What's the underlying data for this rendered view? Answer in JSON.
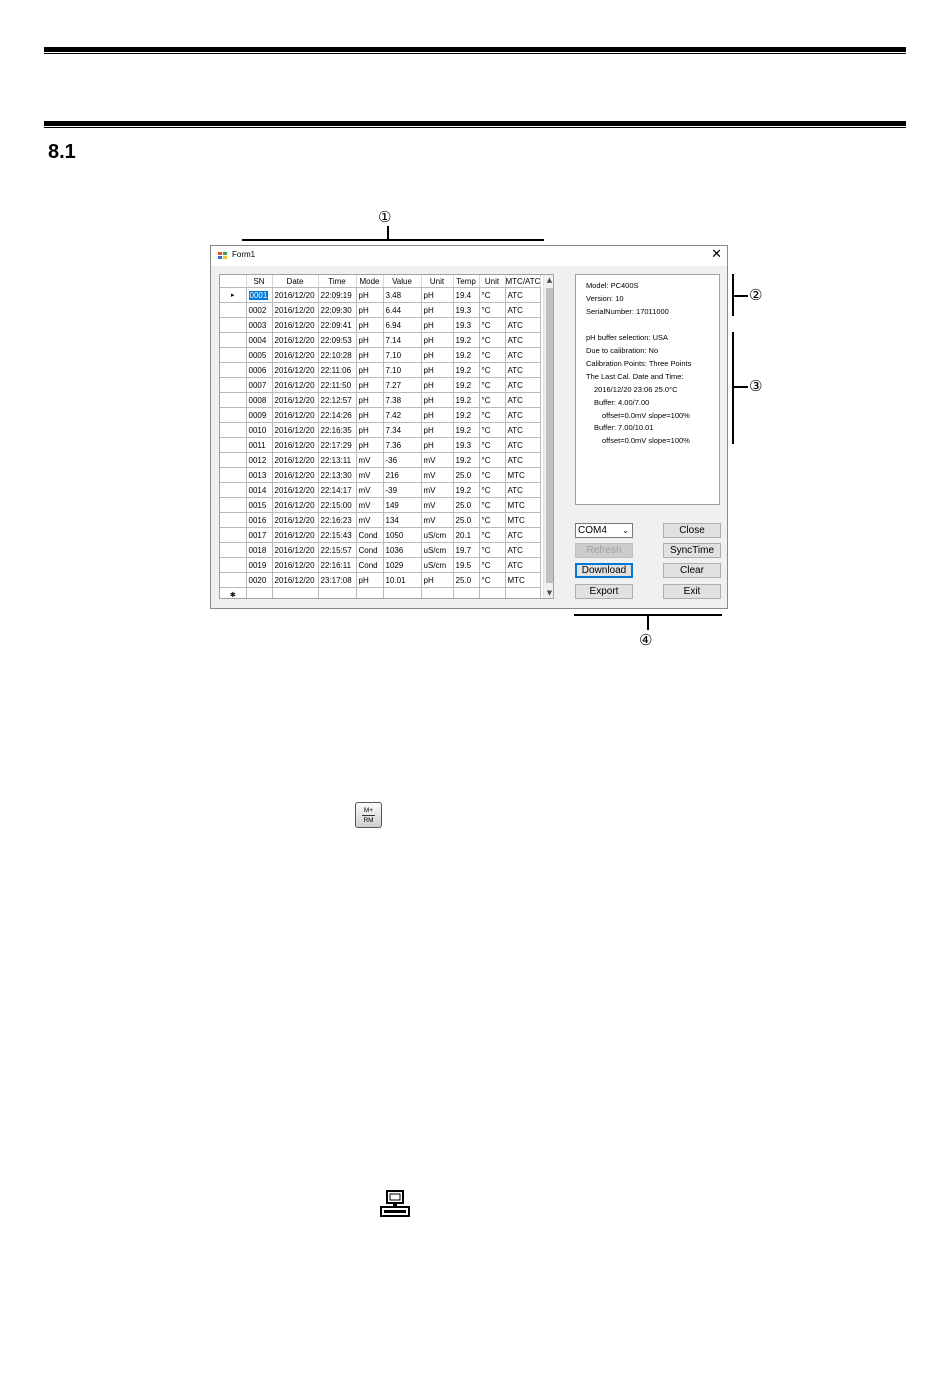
{
  "section": {
    "number": "8.1"
  },
  "callouts": [
    "①",
    "②",
    "③",
    "④"
  ],
  "window": {
    "title": "Form1",
    "close_glyph": "✕",
    "columns": [
      "SN",
      "Date",
      "Time",
      "Mode",
      "Value",
      "Unit",
      "Temp",
      "Unit",
      "MTC/ATC"
    ],
    "rows": [
      [
        "0001",
        "2016/12/20",
        "22:09:19",
        "pH",
        "3.48",
        "pH",
        "19.4",
        "°C",
        "ATC"
      ],
      [
        "0002",
        "2016/12/20",
        "22:09:30",
        "pH",
        "6.44",
        "pH",
        "19.3",
        "°C",
        "ATC"
      ],
      [
        "0003",
        "2016/12/20",
        "22:09:41",
        "pH",
        "6.94",
        "pH",
        "19.3",
        "°C",
        "ATC"
      ],
      [
        "0004",
        "2016/12/20",
        "22:09:53",
        "pH",
        "7.14",
        "pH",
        "19.2",
        "°C",
        "ATC"
      ],
      [
        "0005",
        "2016/12/20",
        "22:10:28",
        "pH",
        "7.10",
        "pH",
        "19.2",
        "°C",
        "ATC"
      ],
      [
        "0006",
        "2016/12/20",
        "22:11:06",
        "pH",
        "7.10",
        "pH",
        "19.2",
        "°C",
        "ATC"
      ],
      [
        "0007",
        "2016/12/20",
        "22:11:50",
        "pH",
        "7.27",
        "pH",
        "19.2",
        "°C",
        "ATC"
      ],
      [
        "0008",
        "2016/12/20",
        "22:12:57",
        "pH",
        "7.38",
        "pH",
        "19.2",
        "°C",
        "ATC"
      ],
      [
        "0009",
        "2016/12/20",
        "22:14:26",
        "pH",
        "7.42",
        "pH",
        "19.2",
        "°C",
        "ATC"
      ],
      [
        "0010",
        "2016/12/20",
        "22:16:35",
        "pH",
        "7.34",
        "pH",
        "19.2",
        "°C",
        "ATC"
      ],
      [
        "0011",
        "2016/12/20",
        "22:17:29",
        "pH",
        "7.36",
        "pH",
        "19.3",
        "°C",
        "ATC"
      ],
      [
        "0012",
        "2016/12/20",
        "22:13:11",
        "mV",
        "-36",
        "mV",
        "19.2",
        "°C",
        "ATC"
      ],
      [
        "0013",
        "2016/12/20",
        "22:13:30",
        "mV",
        "216",
        "mV",
        "25.0",
        "°C",
        "MTC"
      ],
      [
        "0014",
        "2016/12/20",
        "22:14:17",
        "mV",
        "-39",
        "mV",
        "19.2",
        "°C",
        "ATC"
      ],
      [
        "0015",
        "2016/12/20",
        "22:15:00",
        "mV",
        "149",
        "mV",
        "25.0",
        "°C",
        "MTC"
      ],
      [
        "0016",
        "2016/12/20",
        "22:16:23",
        "mV",
        "134",
        "mV",
        "25.0",
        "°C",
        "MTC"
      ],
      [
        "0017",
        "2016/12/20",
        "22:15:43",
        "Cond",
        "1050",
        "uS/cm",
        "20.1",
        "°C",
        "ATC"
      ],
      [
        "0018",
        "2016/12/20",
        "22:15:57",
        "Cond",
        "1036",
        "uS/cm",
        "19.7",
        "°C",
        "ATC"
      ],
      [
        "0019",
        "2016/12/20",
        "22:16:11",
        "Cond",
        "1029",
        "uS/cm",
        "19.5",
        "°C",
        "ATC"
      ],
      [
        "0020",
        "2016/12/20",
        "23:17:08",
        "pH",
        "10.01",
        "pH",
        "25.0",
        "°C",
        "MTC"
      ]
    ],
    "current_row_marker": "▸",
    "new_row_marker": "✱",
    "scroll_up": "▲",
    "scroll_down": "▼",
    "info_lines": [
      "Model: PC400S",
      "Version: 10",
      "SerialNumber: 17011000",
      "pH buffer selection: USA",
      "Due to calibration: No",
      "Calibration Points: Three Points",
      "The Last Cal. Date and Time:",
      "2016/12/20  23:06    25.0°C",
      "Buffer: 4.00/7.00",
      "offset=0.0mV    slope=100%",
      "Buffer: 7.00/10.01",
      "offset=0.0mV    slope=100%"
    ],
    "port": {
      "value": "COM4",
      "dropdown_glyph": "⌄"
    },
    "buttons": {
      "close": "Close",
      "refresh": "Refresh",
      "synctime": "SyncTime",
      "download": "Download",
      "clear": "Clear",
      "export": "Export",
      "exit": "Exit"
    }
  },
  "key_icon": {
    "top": "M+",
    "bottom": "RM"
  },
  "icons": {
    "app": "app-icon",
    "key": "mr-rm-key-icon",
    "pc": "computer-icon"
  }
}
